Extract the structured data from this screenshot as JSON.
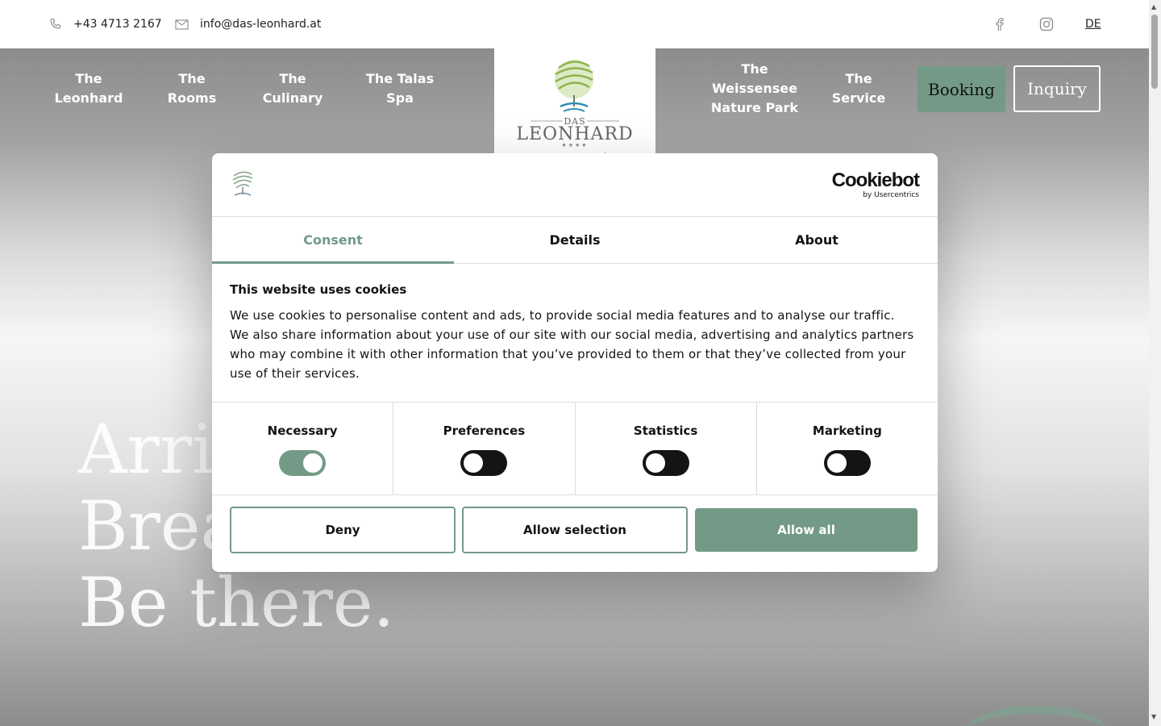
{
  "contact": {
    "phone": "+43 4713 2167",
    "email": "info@das-leonhard.at",
    "phone_icon": "phone-icon",
    "email_icon": "mail-icon"
  },
  "social": [
    "facebook-icon",
    "instagram-icon"
  ],
  "language": "DE",
  "nav": {
    "left": [
      "The Leonhard",
      "The Rooms",
      "The Culinary",
      "The Talas Spa"
    ],
    "right": [
      "The Weissensee Nature Park",
      "The Service"
    ],
    "booking": "Booking",
    "inquiry": "Inquiry"
  },
  "logo": {
    "small": "DAS",
    "big": "LEONHARD",
    "stars": "★★★★"
  },
  "hero": {
    "line1": "Arriv",
    "line2": "Brea",
    "line3": "Be there."
  },
  "cookie": {
    "brand": "Cookiebot",
    "brand_sub": "by Usercentrics",
    "tabs": [
      "Consent",
      "Details",
      "About"
    ],
    "title": "This website uses cookies",
    "body": "We use cookies to personalise content and ads, to provide social media features and to analyse our traffic. We also share information about your use of our site with our social media, advertising and analytics partners who may combine it with other information that you’ve provided to them or that they’ve collected from your use of their services.",
    "toggles": [
      {
        "label": "Necessary",
        "on": true
      },
      {
        "label": "Preferences",
        "on": false
      },
      {
        "label": "Statistics",
        "on": false
      },
      {
        "label": "Marketing",
        "on": false
      }
    ],
    "buttons": {
      "deny": "Deny",
      "selection": "Allow selection",
      "all": "Allow all"
    }
  },
  "colors": {
    "accent": "#739a87",
    "text": "#141414"
  }
}
